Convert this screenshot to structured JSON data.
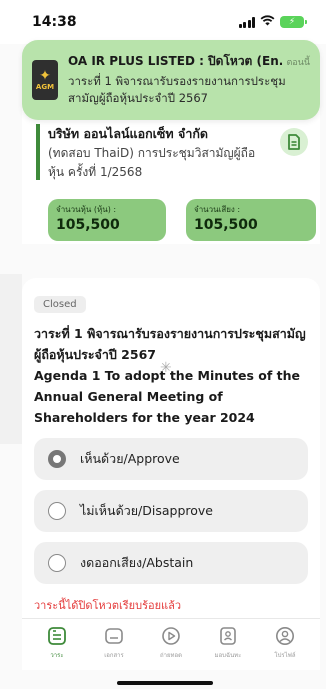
{
  "status_bar": {
    "time": "14:38"
  },
  "notification": {
    "logo_text": "AGM",
    "title": "OA IR PLUS LISTED : ปิดโหวต (En...",
    "time": "ตอนนี้",
    "body": "วาระที่ 1 พิจารณารับรองรายงานการประชุมสามัญผู้ถือหุ้นประจำปี 2567"
  },
  "meeting": {
    "company": "บริษัท ออนไลน์แอกเซ็ท จำกัด",
    "description": "(ทดสอบ ThaiD) การประชุมวิสามัญผู้ถือหุ้น ครั้งที่ 1/2568",
    "shares_label": "จำนวนหุ้น (หุ้น) :",
    "shares_value": "105,500",
    "votes_label": "จำนวนเสียง :",
    "votes_value": "105,500"
  },
  "agenda": {
    "status": "Closed",
    "title_th": "วาระที่ 1 พิจารณารับรองรายงานการประชุมสามัญผู้ถือหุ้นประจำปี 2567",
    "title_en": "Agenda 1 To adopt the Minutes of the Annual General Meeting of Shareholders for the year 2024",
    "options": [
      {
        "label": "เห็นด้วย/Approve",
        "selected": true
      },
      {
        "label": "ไม่เห็นด้วย/Disapprove",
        "selected": false
      },
      {
        "label": "งดออกเสียง/Abstain",
        "selected": false
      }
    ],
    "closed_note": "วาระนี้ได้ปิดโหวตเรียบร้อยแล้ว"
  },
  "tabs": [
    {
      "label": "วาระ",
      "icon": "agenda-icon"
    },
    {
      "label": "เอกสาร",
      "icon": "document-icon"
    },
    {
      "label": "ถ่ายทอด",
      "icon": "play-icon"
    },
    {
      "label": "มอบฉันทะ",
      "icon": "proxy-icon"
    },
    {
      "label": "โปรไฟล์",
      "icon": "profile-icon"
    }
  ],
  "colors": {
    "accent": "#3e8a3a",
    "notification_bg": "#b8e3ab",
    "stat_bg": "#8cc97e",
    "closed_note": "#e43b3b"
  }
}
